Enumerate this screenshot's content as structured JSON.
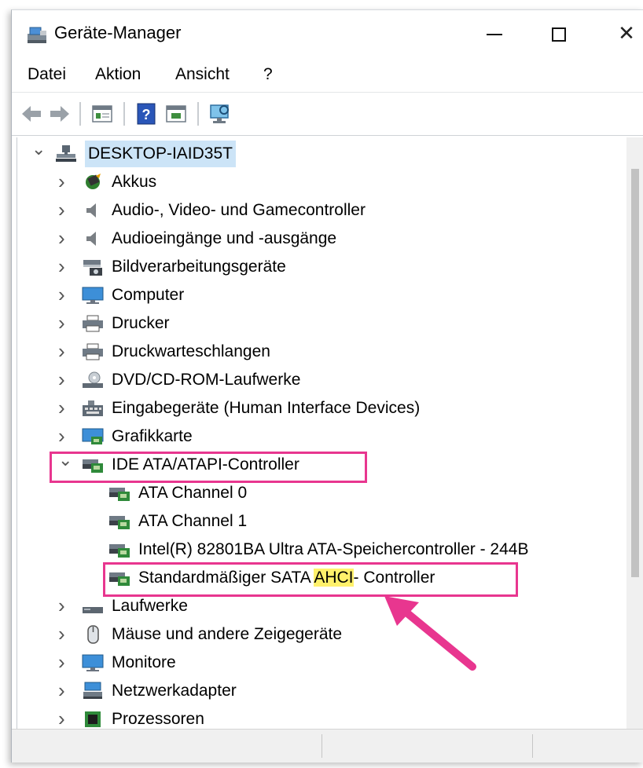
{
  "window": {
    "title": "Geräte-Manager",
    "controls": [
      "minimize",
      "maximize",
      "close"
    ]
  },
  "menu": [
    {
      "label": "Datei"
    },
    {
      "label": "Aktion"
    },
    {
      "label": "Ansicht"
    },
    {
      "label": "?"
    }
  ],
  "toolbar": {
    "buttons": [
      "back-arrow-icon",
      "forward-arrow-icon",
      "properties-icon",
      "help-icon",
      "update-driver-icon",
      "scan-hardware-icon"
    ]
  },
  "tree": {
    "root": "DESKTOP-IAID35T",
    "items": [
      {
        "label": "Akkus",
        "icon": "battery-icon"
      },
      {
        "label": "Audio-, Video- und Gamecontroller",
        "icon": "speaker-icon"
      },
      {
        "label": "Audioeingänge und -ausgänge",
        "icon": "speaker-icon"
      },
      {
        "label": "Bildverarbeitungsgeräte",
        "icon": "camera-icon"
      },
      {
        "label": "Computer",
        "icon": "monitor-icon"
      },
      {
        "label": "Drucker",
        "icon": "printer-icon"
      },
      {
        "label": "Druckwarteschlangen",
        "icon": "printer-icon"
      },
      {
        "label": "DVD/CD-ROM-Laufwerke",
        "icon": "disc-drive-icon"
      },
      {
        "label": "Eingabegeräte (Human Interface Devices)",
        "icon": "keyboard-icon"
      },
      {
        "label": "Grafikkarte",
        "icon": "display-adapter-icon"
      },
      {
        "label": "IDE ATA/ATAPI-Controller",
        "icon": "controller-icon",
        "expanded": true
      },
      {
        "label": "ATA Channel 0",
        "icon": "controller-icon",
        "child": true
      },
      {
        "label": "ATA Channel 1",
        "icon": "controller-icon",
        "child": true
      },
      {
        "label": "Intel(R) 82801BA Ultra ATA-Speichercontroller - 244B",
        "icon": "controller-icon",
        "child": true
      },
      {
        "label_pre": "Standardmäßiger SATA ",
        "label_hl": "AHCI",
        "label_post": "- Controller",
        "icon": "controller-icon",
        "child": true
      },
      {
        "label": "Laufwerke",
        "icon": "drive-icon"
      },
      {
        "label": "Mäuse und andere Zeigegeräte",
        "icon": "mouse-icon"
      },
      {
        "label": "Monitore",
        "icon": "monitor-icon"
      },
      {
        "label": "Netzwerkadapter",
        "icon": "network-icon"
      },
      {
        "label": "Prozessoren",
        "icon": "processor-icon"
      }
    ]
  },
  "colors": {
    "highlight_box": "#e8368f",
    "arrow": "#e8368f",
    "text_highlight": "#fff16b",
    "selection": "#cce4f7"
  }
}
